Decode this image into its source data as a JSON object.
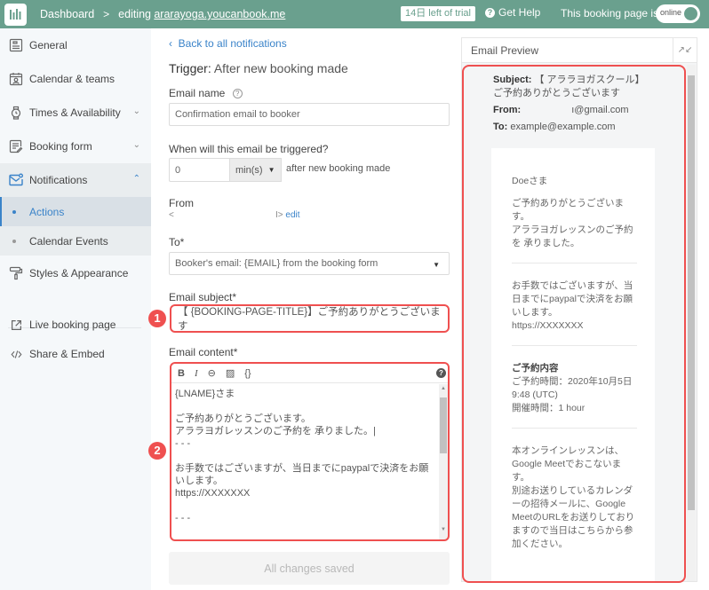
{
  "header": {
    "logo_icon": "youcanbook-logo-icon",
    "breadcrumb_root": "Dashboard",
    "breadcrumb_sep": ">",
    "editing_prefix": "editing",
    "site": "ararayoga.youcanbook.me",
    "trial": "14日 left of trial",
    "help": "Get Help",
    "booking_page_label": "This booking page is",
    "toggle_state": "online"
  },
  "sidebar": {
    "items": [
      {
        "label": "General",
        "icon": "id-card-icon"
      },
      {
        "label": "Calendar & teams",
        "icon": "calendar-user-icon"
      },
      {
        "label": "Times & Availability",
        "icon": "watch-icon",
        "chevron": "⌄"
      },
      {
        "label": "Booking form",
        "icon": "form-edit-icon",
        "chevron": "⌄"
      },
      {
        "label": "Notifications",
        "icon": "mail-notification-icon",
        "chevron": "⌃"
      }
    ],
    "subitems": [
      {
        "label": "Actions",
        "active": true
      },
      {
        "label": "Calendar Events",
        "active": false
      }
    ],
    "styles": {
      "label": "Styles & Appearance",
      "icon": "paint-roller-icon"
    },
    "links": [
      {
        "label": "Live booking page",
        "icon": "external-link-icon"
      },
      {
        "label": "Share & Embed",
        "icon": "code-icon"
      }
    ]
  },
  "form": {
    "back": "Back to all notifications",
    "trigger_label": "Trigger:",
    "trigger_value": "After new booking made",
    "email_name_label": "Email name",
    "email_name_value": "Confirmation email to booker",
    "when_label": "When will this email be triggered?",
    "when_value": "0",
    "when_unit": "min(s)",
    "when_suffix": "after new booking made",
    "from_label": "From",
    "from_value_start": "<",
    "from_value_end": "I>",
    "from_edit": "edit",
    "to_label": "To*",
    "to_value": "Booker's email: {EMAIL} from the booking form",
    "subject_label": "Email subject*",
    "subject_value": "【 {BOOKING-PAGE-TITLE}】ご予約ありがとうございます",
    "content_label": "Email content*",
    "toolbar": {
      "bold": "B",
      "italic": "I",
      "link": "⊖",
      "image": "▨",
      "variables": "{}",
      "help": "?"
    },
    "content_lines": [
      "{LNAME}さま",
      "",
      "ご予約ありがとうございます。",
      "アララヨガレッスンのご予約を 承りました。|",
      "- - -",
      "",
      "お手数ではございますが、当日までにpaypalで決済をお願",
      "いします。",
      "https://XXXXXXX",
      "",
      "- - -"
    ],
    "save": "All changes saved"
  },
  "annotations": {
    "badge1": "1",
    "badge2": "2",
    "color": "#ef5050"
  },
  "preview": {
    "title": "Email Preview",
    "subject_label": "Subject:",
    "subject_value": "【 アララヨガスクール】ご予約ありがとうございます",
    "from_label": "From:",
    "from_value": "ı@gmail.com",
    "to_label": "To:",
    "to_value": "example@example.com",
    "greeting": "Doeさま",
    "sec1": [
      "ご予約ありがとうございま",
      "す。",
      "アララヨガレッスンのご予約",
      "を 承りました。"
    ],
    "sec2": [
      "お手数ではございますが、当",
      "日までにpaypalで決済をお願",
      "いします。",
      "https://XXXXXXX"
    ],
    "sec3_title": "ご予約内容",
    "sec3": [
      "ご予約時間：2020年10月5日",
      "9:48 (UTC)",
      "開催時間：1 hour"
    ],
    "sec4": [
      "本オンラインレッスンは、",
      "Google Meetでおこないます。",
      "別途お送りしているカレンダ",
      "ーの招待メールに、Google",
      "MeetのURLをお送りしており",
      "ますので当日はこちらから参",
      "加ください。"
    ]
  },
  "colors": {
    "brand": "#6aa08e",
    "link": "#3a83c9",
    "highlight": "#ef5050"
  }
}
